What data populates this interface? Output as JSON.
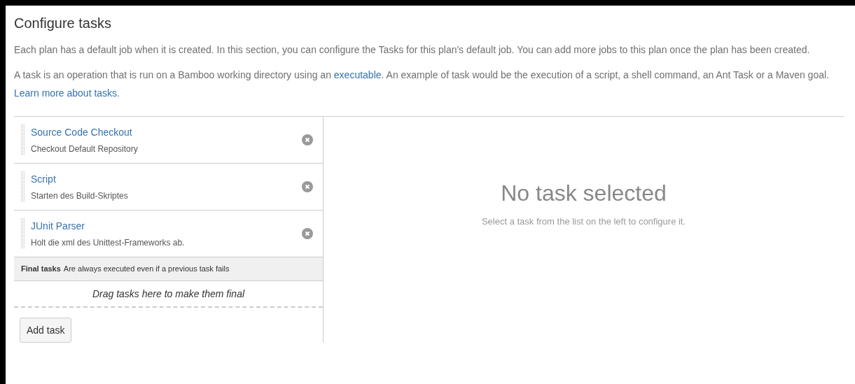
{
  "title": "Configure tasks",
  "paragraphs": [
    [
      {
        "kind": "text",
        "text": "Each plan has a default job when it is created. In this section, you can configure the Tasks for this plan's default job. You can add more jobs to this plan once the plan has been created."
      }
    ],
    [
      {
        "kind": "text",
        "text": "A task is an operation that is run on a Bamboo working directory using an "
      },
      {
        "kind": "link",
        "text": "executable"
      },
      {
        "kind": "text",
        "text": ". An example of task would be the execution of a script, a shell command, an Ant Task or a Maven goal. "
      },
      {
        "kind": "link",
        "text": "Learn more about tasks"
      },
      {
        "kind": "text",
        "text": "."
      }
    ]
  ],
  "tasks": [
    {
      "name": "Source Code Checkout",
      "description": "Checkout Default Repository"
    },
    {
      "name": "Script",
      "description": "Starten des Build-Skriptes"
    },
    {
      "name": "JUnit Parser",
      "description": "Holt die xml des Unittest-Frameworks ab."
    }
  ],
  "final_tasks": {
    "label": "Final tasks",
    "note": "Are always executed even if a previous task fails",
    "drop_hint": "Drag tasks here to make them final"
  },
  "add_button": "Add task",
  "empty_state": {
    "heading": "No task selected",
    "message": "Select a task from the list on the left to configure it."
  }
}
